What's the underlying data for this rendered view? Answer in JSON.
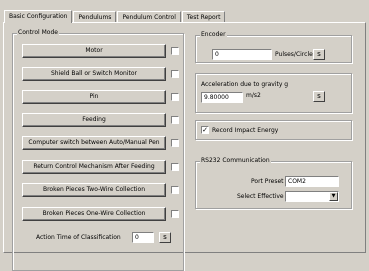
{
  "tabs": [
    {
      "label": "Basic Configuration"
    },
    {
      "label": "Pendulums"
    },
    {
      "label": "Pendulum Control"
    },
    {
      "label": "Test Report"
    }
  ],
  "control_mode": {
    "title": "Control Mode",
    "buttons": [
      {
        "label": "Motor"
      },
      {
        "label": "Shield Ball or Switch Monitor"
      },
      {
        "label": "Pin"
      },
      {
        "label": "Feeding"
      },
      {
        "label": "Computer switch between Auto/Manual Pen"
      },
      {
        "label": "Return Control Mechanism After Feeding"
      },
      {
        "label": "Broken Pieces Two-Wire Collection"
      },
      {
        "label": "Broken Pieces One-Wire Collection"
      }
    ],
    "action_time_label": "Action Time of Classification",
    "action_time_value": "0",
    "action_time_btn": "s"
  },
  "encoder": {
    "title": "Encoder",
    "value": "0",
    "unit": "Pulses/Circle",
    "btn": "s"
  },
  "acceleration": {
    "label": "Acceleration due to gravity g",
    "value": "9.80000",
    "unit": "m/s2",
    "btn": "s"
  },
  "record_impact": {
    "label": "Record Impact Energy",
    "checked": true
  },
  "rs232": {
    "title": "RS232 Communication",
    "port_preset_label": "Port Preset",
    "port_preset_value": "COM2",
    "effective_port_label": "Select Effective Port",
    "effective_port_value": ""
  }
}
